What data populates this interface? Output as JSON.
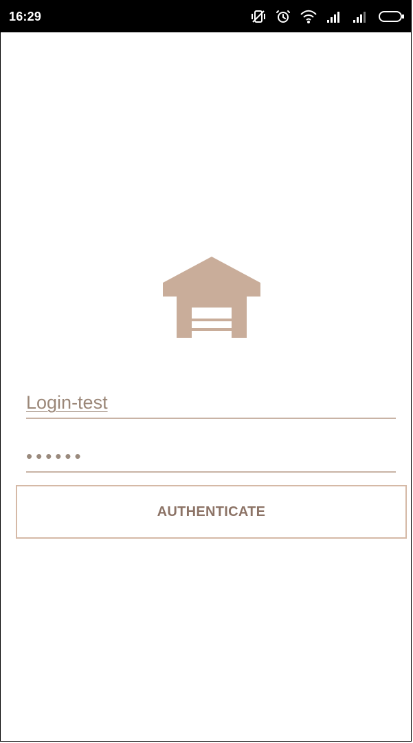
{
  "status_bar": {
    "time": "16:29",
    "icons": [
      "vibrate-off-icon",
      "alarm-icon",
      "wifi-icon",
      "signal-icon",
      "signal-weak-icon",
      "battery-icon"
    ]
  },
  "app": {
    "logo_icon": "warehouse-icon",
    "colors": {
      "accent": "#c9ad9a",
      "button_border": "#d5b9a6",
      "button_text": "#8c7366",
      "field_text": "#9b8778",
      "field_line": "#c8b3a5",
      "status_bar": "#000000"
    }
  },
  "form": {
    "login_value": "Login-test",
    "password_value": "••••••",
    "submit_label": "AUTHENTICATE"
  }
}
